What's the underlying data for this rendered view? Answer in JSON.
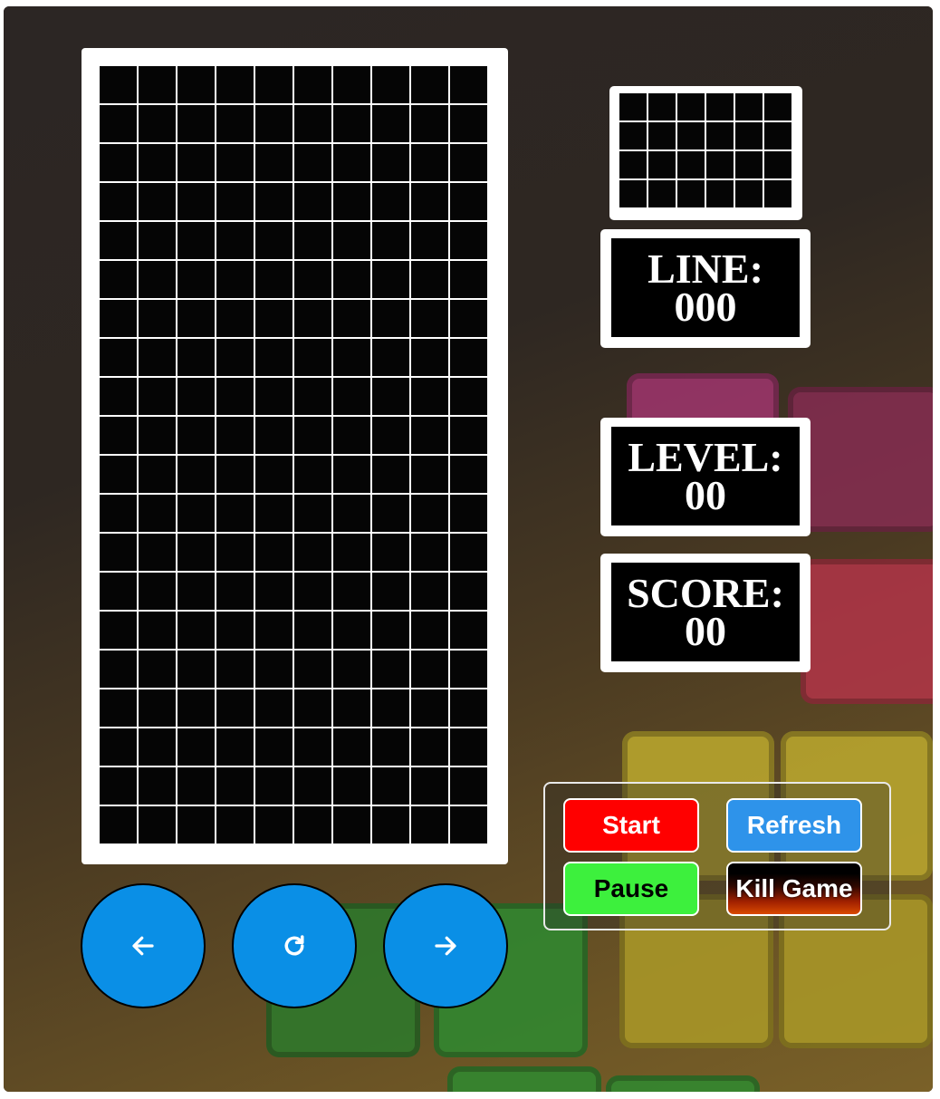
{
  "stats": {
    "line_label": "LINE:",
    "line_value": "000",
    "level_label": "LEVEL:",
    "level_value": "00",
    "score_label": "SCORE:",
    "score_value": "00"
  },
  "buttons": {
    "start": "Start",
    "refresh": "Refresh",
    "pause": "Pause",
    "kill": "Kill Game"
  },
  "arrows": {
    "left_icon": "arrow-left-icon",
    "rotate_icon": "rotate-icon",
    "right_icon": "arrow-right-icon"
  },
  "colors": {
    "start": "#ff0000",
    "refresh": "#2e93ea",
    "pause": "#3df03d",
    "arrow_button": "#0a8fe6"
  }
}
